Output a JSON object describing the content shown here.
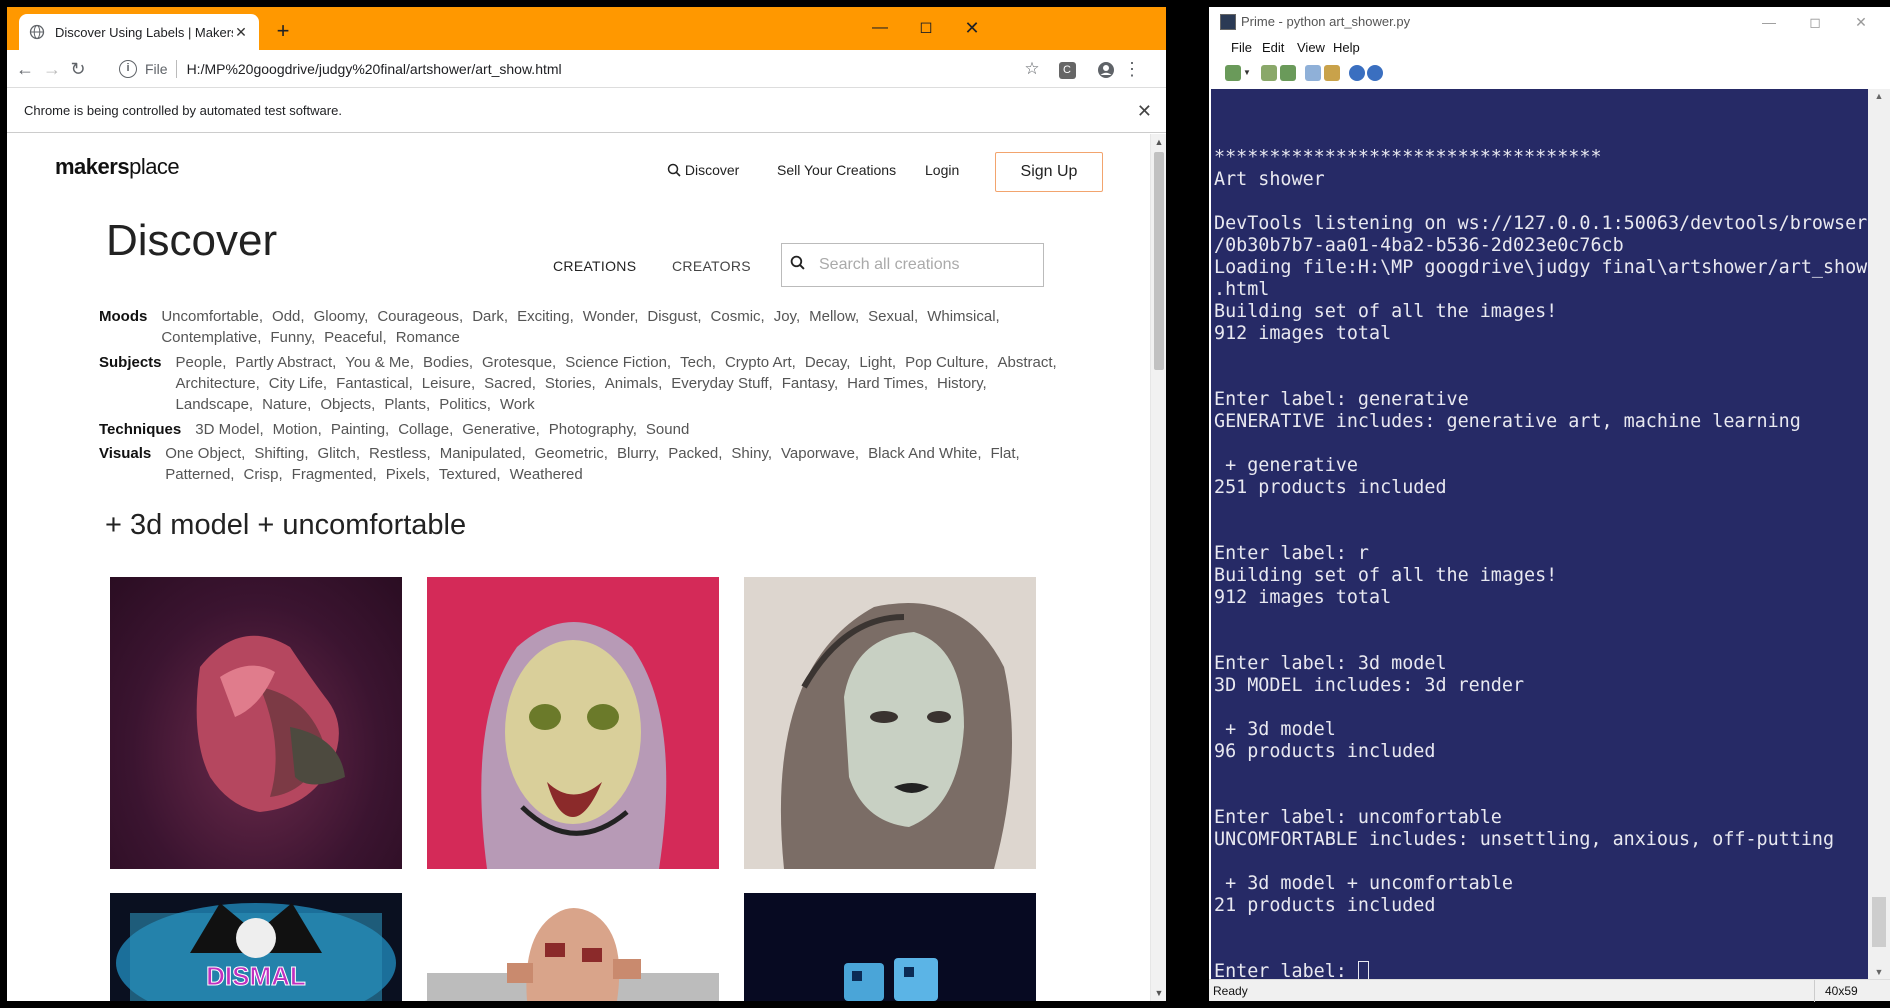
{
  "chrome": {
    "tab_title": "Discover Using Labels | MakersPl",
    "tab_close": "✕",
    "new_tab": "+",
    "url_scheme": "File",
    "url": "H:/MP%20googdrive/judgy%20final/artshower/art_show.html",
    "infobar_text": "Chrome is being controlled by automated test software.",
    "colors": {
      "titlebar": "#ff9800"
    }
  },
  "site": {
    "logo_bold": "makers",
    "logo_light": "place",
    "nav": {
      "discover": "Discover",
      "sell": "Sell Your Creations",
      "login": "Login",
      "signup": "Sign Up"
    },
    "title": "Discover",
    "toggle": {
      "creations": "CREATIONS",
      "creators": "CREATORS"
    },
    "search_placeholder": "Search all creations",
    "labels": {
      "moods": {
        "name": "Moods",
        "items": [
          "Uncomfortable,",
          "Odd,",
          "Gloomy,",
          "Courageous,",
          "Dark,",
          "Exciting,",
          "Wonder,",
          "Disgust,",
          "Cosmic,",
          "Joy,",
          "Mellow,",
          "Sexual,",
          "Whimsical,",
          "Contemplative,",
          "Funny,",
          "Peaceful,",
          "Romance"
        ]
      },
      "subjects": {
        "name": "Subjects",
        "items": [
          "People,",
          "Partly Abstract,",
          "You & Me,",
          "Bodies,",
          "Grotesque,",
          "Science Fiction,",
          "Tech,",
          "Crypto Art,",
          "Decay,",
          "Light,",
          "Pop Culture,",
          "Abstract,",
          "Architecture,",
          "City Life,",
          "Fantastical,",
          "Leisure,",
          "Sacred,",
          "Stories,",
          "Animals,",
          "Everyday Stuff,",
          "Fantasy,",
          "Hard Times,",
          "History,",
          "Landscape,",
          "Nature,",
          "Objects,",
          "Plants,",
          "Politics,",
          "Work"
        ]
      },
      "techniques": {
        "name": "Techniques",
        "items": [
          "3D Model,",
          "Motion,",
          "Painting,",
          "Collage,",
          "Generative,",
          "Photography,",
          "Sound"
        ]
      },
      "visuals": {
        "name": "Visuals",
        "items": [
          "One Object,",
          "Shifting,",
          "Glitch,",
          "Restless,",
          "Manipulated,",
          "Geometric,",
          "Blurry,",
          "Packed,",
          "Shiny,",
          "Vaporwave,",
          "Black And White,",
          "Flat,",
          "Patterned,",
          "Crisp,",
          "Fragmented,",
          "Pixels,",
          "Textured,",
          "Weathered"
        ]
      }
    },
    "results_heading": "+ 3d model + uncomfortable"
  },
  "console": {
    "title": "Prime - python  art_shower.py",
    "menu": [
      "File",
      "Edit",
      "View",
      "Help"
    ],
    "lines": [
      "***********************************",
      "Art shower",
      "",
      "DevTools listening on ws://127.0.0.1:50063/devtools/browser",
      "/0b30b7b7-aa01-4ba2-b536-2d023e0c76cb",
      "Loading file:H:\\MP googdrive\\judgy final\\artshower/art_show",
      ".html",
      "Building set of all the images!",
      "912 images total",
      "",
      "",
      "Enter label: generative",
      "GENERATIVE includes: generative art, machine learning",
      "",
      " + generative",
      "251 products included",
      "",
      "",
      "Enter label: r",
      "Building set of all the images!",
      "912 images total",
      "",
      "",
      "Enter label: 3d model",
      "3D MODEL includes: 3d render",
      "",
      " + 3d model",
      "96 products included",
      "",
      "",
      "Enter label: uncomfortable",
      "UNCOMFORTABLE includes: unsettling, anxious, off-putting",
      "",
      " + 3d model + uncomfortable",
      "21 products included",
      "",
      ""
    ],
    "prompt": "Enter label: ",
    "status": "Ready",
    "size": "40x59",
    "colors": {
      "background": "#262a66",
      "text": "#e8e8f0"
    }
  }
}
